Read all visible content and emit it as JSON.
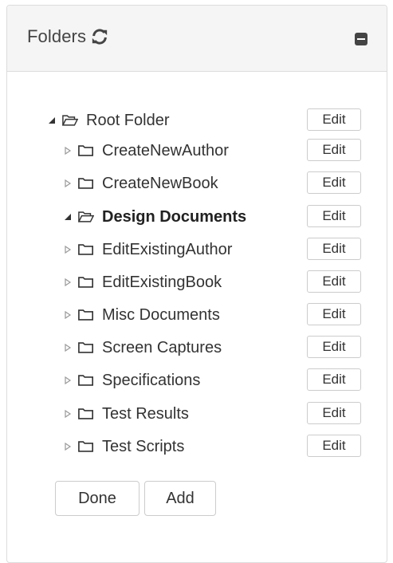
{
  "header": {
    "title": "Folders",
    "refresh_icon": "refresh-icon",
    "collapse_icon": "minus-square-icon"
  },
  "tree": {
    "root": {
      "label": "Root Folder",
      "expanded": true,
      "edit_label": "Edit"
    },
    "children": [
      {
        "label": "CreateNewAuthor",
        "expanded": false,
        "selected": false,
        "edit_label": "Edit"
      },
      {
        "label": "CreateNewBook",
        "expanded": false,
        "selected": false,
        "edit_label": "Edit"
      },
      {
        "label": "Design Documents",
        "expanded": true,
        "selected": true,
        "edit_label": "Edit"
      },
      {
        "label": "EditExistingAuthor",
        "expanded": false,
        "selected": false,
        "edit_label": "Edit"
      },
      {
        "label": "EditExistingBook",
        "expanded": false,
        "selected": false,
        "edit_label": "Edit"
      },
      {
        "label": "Misc Documents",
        "expanded": false,
        "selected": false,
        "edit_label": "Edit"
      },
      {
        "label": "Screen Captures",
        "expanded": false,
        "selected": false,
        "edit_label": "Edit"
      },
      {
        "label": "Specifications",
        "expanded": false,
        "selected": false,
        "edit_label": "Edit"
      },
      {
        "label": "Test Results",
        "expanded": false,
        "selected": false,
        "edit_label": "Edit"
      },
      {
        "label": "Test Scripts",
        "expanded": false,
        "selected": false,
        "edit_label": "Edit"
      }
    ]
  },
  "actions": {
    "done_label": "Done",
    "add_label": "Add"
  },
  "colors": {
    "header_bg": "#f5f5f5",
    "border": "#dcdcdc",
    "text": "#333333",
    "folder_stroke": "#333333"
  }
}
